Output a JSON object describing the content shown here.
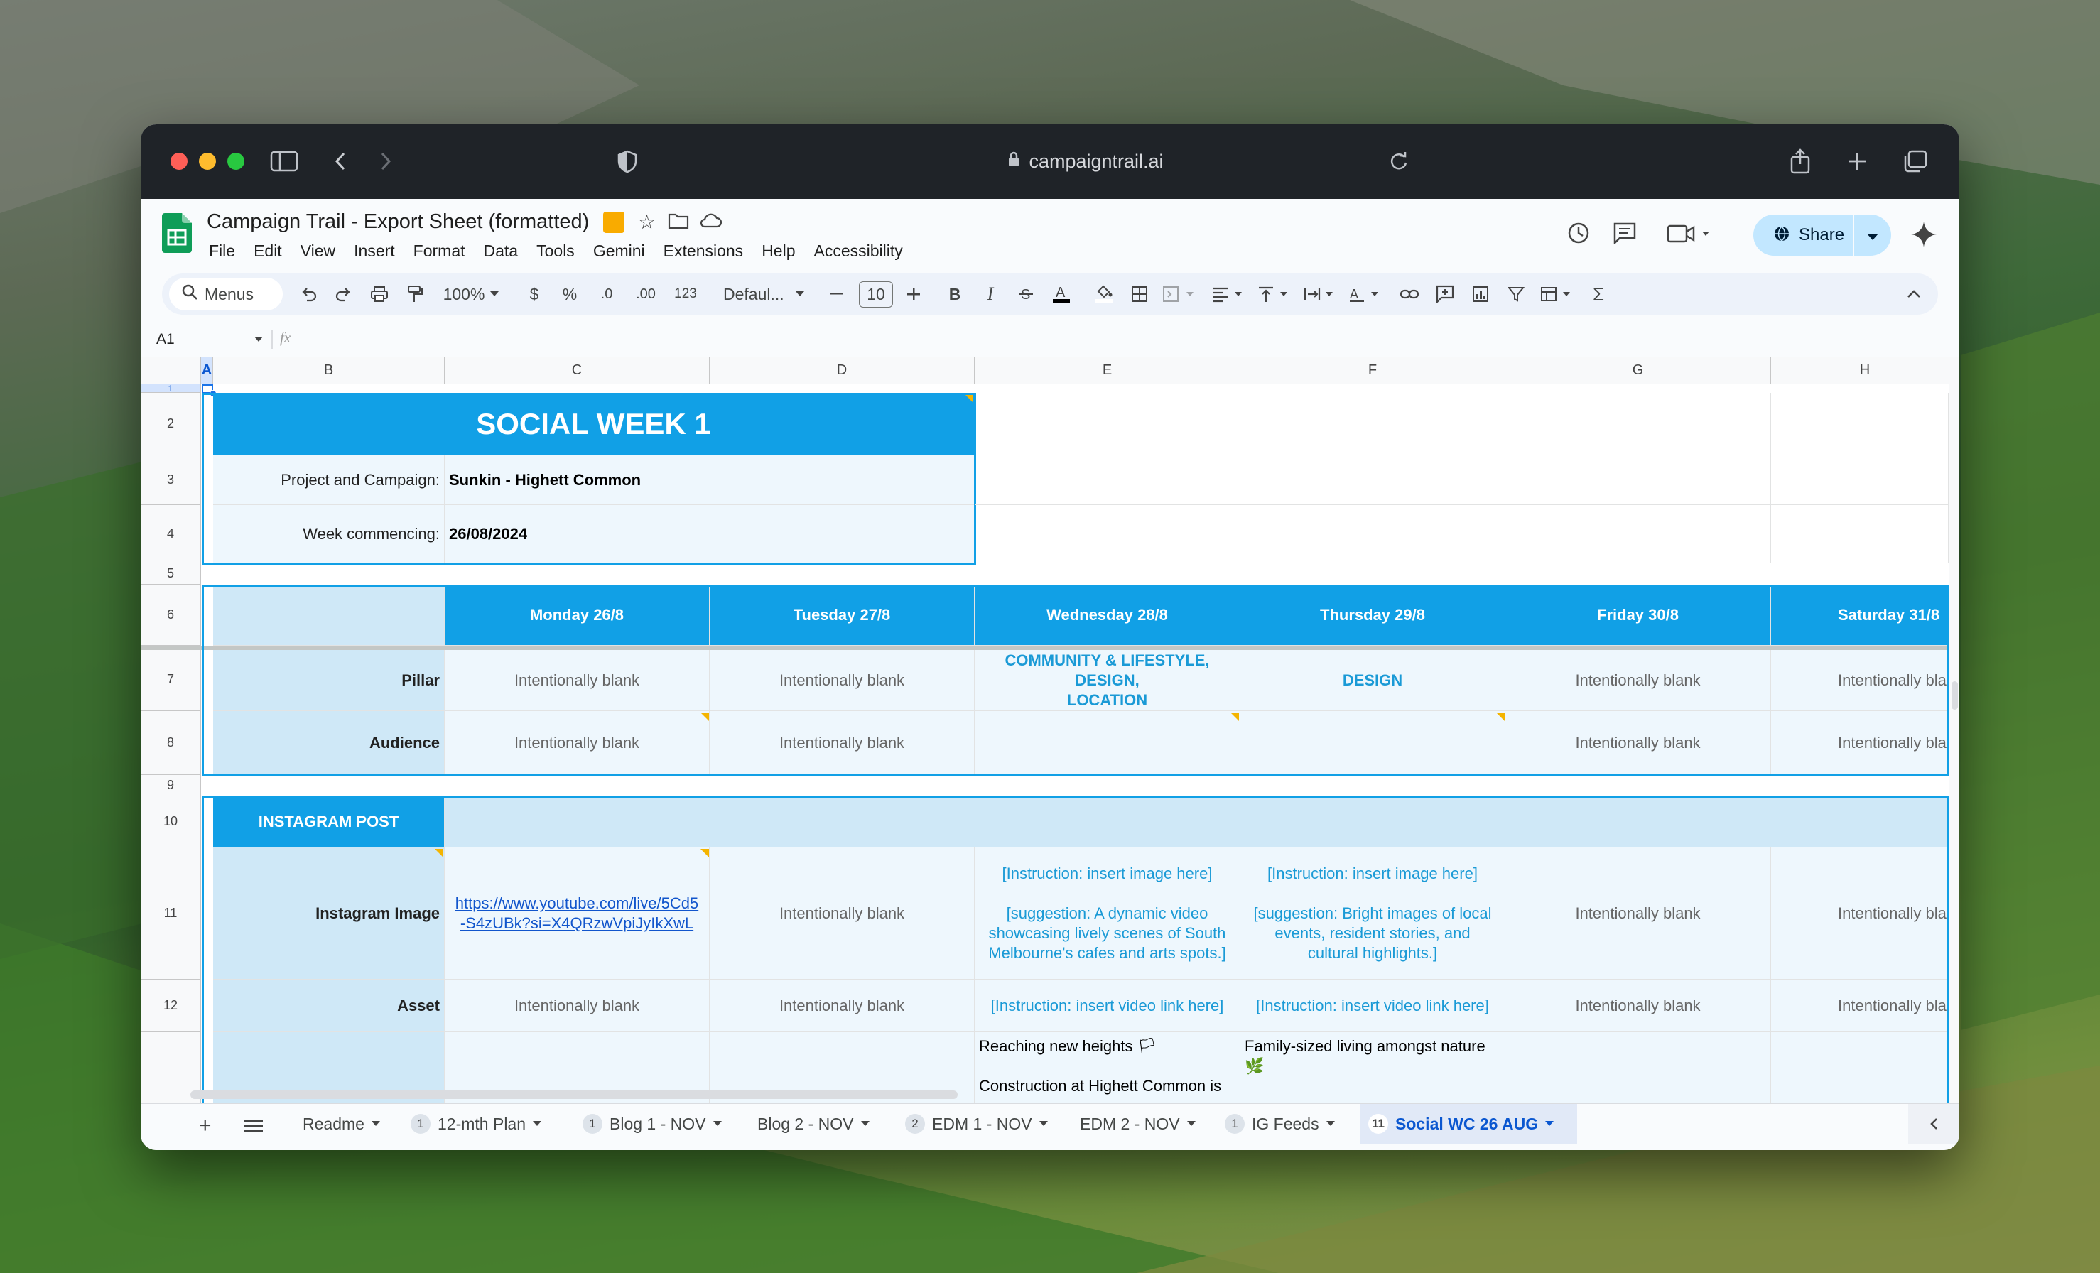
{
  "browser": {
    "url": "campaigntrail.ai"
  },
  "app": {
    "doc_title": "Campaign Trail - Export Sheet (formatted)",
    "menus": [
      "File",
      "Edit",
      "View",
      "Insert",
      "Format",
      "Data",
      "Tools",
      "Gemini",
      "Extensions",
      "Help",
      "Accessibility"
    ],
    "share_label": "Share"
  },
  "toolbar": {
    "search_menus": "Menus",
    "zoom": "100%",
    "currency": "$",
    "percent": "%",
    "dec_decrease": ".0",
    "dec_increase": ".00",
    "number_format": "123",
    "font": "Defaul...",
    "font_size": "10",
    "bold": "B",
    "italic": "I"
  },
  "formula_bar": {
    "cell_ref": "A1",
    "fx": "fx"
  },
  "columns": [
    "A",
    "B",
    "C",
    "D",
    "E",
    "F",
    "G",
    "H"
  ],
  "rows": [
    "1",
    "2",
    "3",
    "4",
    "5",
    "6",
    "7",
    "8",
    "9",
    "10",
    "11",
    "12"
  ],
  "sheet": {
    "title": "SOCIAL WEEK 1",
    "project_label": "Project and Campaign:",
    "project_value": "Sunkin - Highett Common",
    "week_label": "Week commencing:",
    "week_value": "26/08/2024",
    "days": [
      "Monday 26/8",
      "Tuesday 27/8",
      "Wednesday 28/8",
      "Thursday 29/8",
      "Friday 30/8",
      "Saturday 31/8"
    ],
    "pillar_label": "Pillar",
    "audience_label": "Audience",
    "blank": "Intentionally blank",
    "pillar_e1": "COMMUNITY & LIFESTYLE,",
    "pillar_e2": "DESIGN,",
    "pillar_e3": "LOCATION",
    "pillar_f": "DESIGN",
    "insta_post": "INSTAGRAM POST",
    "insta_image_label": "Instagram Image",
    "link_1": "https://www.youtube.com/live/5Cd5",
    "link_2": "-S4zUBk?si=X4QRzwVpiJyIkXwL",
    "instr_image": "[Instruction: insert image here]",
    "sugg_e": "[suggestion: A dynamic video showcasing lively scenes of South Melbourne's cafes and arts spots.]",
    "sugg_f": "[suggestion: Bright images of local events, resident stories, and cultural highlights.]",
    "asset_label": "Asset",
    "instr_video": "[Instruction: insert video link here]",
    "cap_e1": "Reaching new heights 🏳",
    "cap_e2": "Construction at Highett Common is",
    "cap_f1": "Family-sized living amongst nature",
    "cap_f2": "🌿"
  },
  "tabs": [
    {
      "label": "Readme",
      "badge": ""
    },
    {
      "label": "12-mth Plan",
      "badge": "1"
    },
    {
      "label": "Blog 1 - NOV",
      "badge": "1"
    },
    {
      "label": "Blog 2 - NOV",
      "badge": ""
    },
    {
      "label": "EDM 1 - NOV",
      "badge": "2"
    },
    {
      "label": "EDM 2 - NOV",
      "badge": ""
    },
    {
      "label": "IG Feeds",
      "badge": "1"
    },
    {
      "label": "Social WC 26 AUG",
      "badge": "11"
    }
  ]
}
